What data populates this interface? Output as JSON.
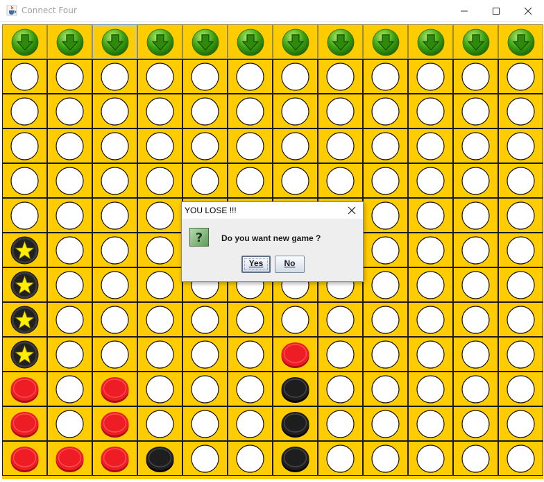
{
  "window": {
    "title": "Connect Four",
    "icon": "java-cup-icon"
  },
  "board": {
    "columns": 12,
    "rows": 12,
    "colors": {
      "background": "#ffcc00",
      "empty": "#ffffff",
      "red": "#ee1c24",
      "black": "#1e1e1e",
      "star": "#ffee00",
      "arrow": "#3aa010"
    },
    "focused_drop_column": 2,
    "grid": [
      [
        "E",
        "E",
        "E",
        "E",
        "E",
        "E",
        "E",
        "E",
        "E",
        "E",
        "E",
        "E"
      ],
      [
        "E",
        "E",
        "E",
        "E",
        "E",
        "E",
        "E",
        "E",
        "E",
        "E",
        "E",
        "E"
      ],
      [
        "E",
        "E",
        "E",
        "E",
        "E",
        "E",
        "E",
        "E",
        "E",
        "E",
        "E",
        "E"
      ],
      [
        "E",
        "E",
        "E",
        "E",
        "E",
        "E",
        "E",
        "E",
        "E",
        "E",
        "E",
        "E"
      ],
      [
        "E",
        "E",
        "E",
        "E",
        "E",
        "E",
        "E",
        "E",
        "E",
        "E",
        "E",
        "E"
      ],
      [
        "S",
        "E",
        "E",
        "E",
        "E",
        "E",
        "E",
        "E",
        "E",
        "E",
        "E",
        "E"
      ],
      [
        "S",
        "E",
        "E",
        "E",
        "E",
        "E",
        "E",
        "E",
        "E",
        "E",
        "E",
        "E"
      ],
      [
        "S",
        "E",
        "E",
        "E",
        "E",
        "E",
        "E",
        "E",
        "E",
        "E",
        "E",
        "E"
      ],
      [
        "S",
        "E",
        "E",
        "E",
        "E",
        "E",
        "R",
        "E",
        "E",
        "E",
        "E",
        "E"
      ],
      [
        "R",
        "E",
        "R",
        "E",
        "E",
        "E",
        "B",
        "E",
        "E",
        "E",
        "E",
        "E"
      ],
      [
        "R",
        "E",
        "R",
        "E",
        "E",
        "E",
        "B",
        "E",
        "E",
        "E",
        "E",
        "E"
      ],
      [
        "R",
        "R",
        "R",
        "B",
        "E",
        "E",
        "B",
        "E",
        "E",
        "E",
        "E",
        "E"
      ]
    ]
  },
  "dialog": {
    "title": "YOU LOSE !!!",
    "message": "Do you want new game ?",
    "icon": "question-icon",
    "yes_label": "Yes",
    "no_label": "No"
  }
}
